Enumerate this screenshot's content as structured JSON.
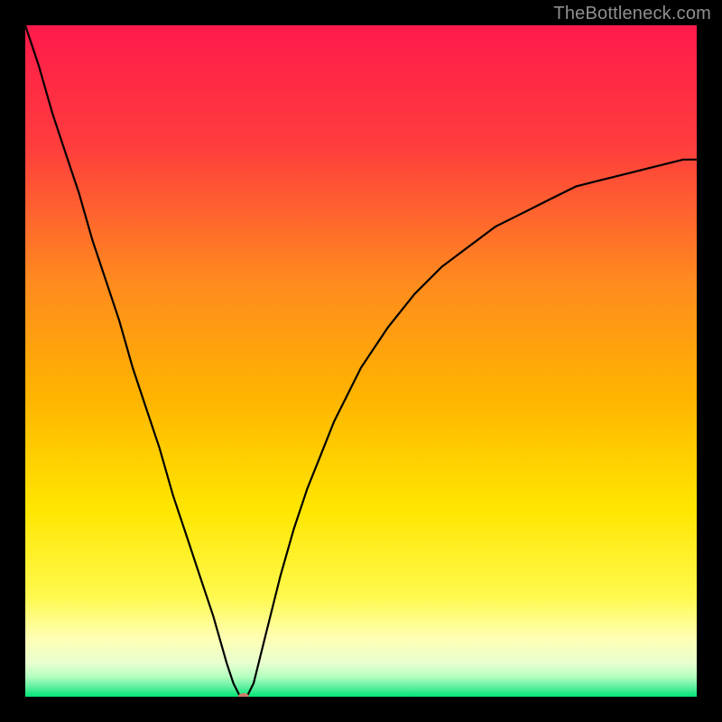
{
  "watermark": "TheBottleneck.com",
  "chart_data": {
    "type": "line",
    "title": "",
    "xlabel": "",
    "ylabel": "",
    "xlim": [
      0,
      100
    ],
    "ylim": [
      0,
      100
    ],
    "background": {
      "description": "vertical gradient mapped to y-value",
      "stops": [
        {
          "y": 100,
          "color": "#ff1a4b"
        },
        {
          "y": 50,
          "color": "#ffb300"
        },
        {
          "y": 28,
          "color": "#ffe600"
        },
        {
          "y": 12,
          "color": "#ffff9e"
        },
        {
          "y": 4,
          "color": "#e8ffd0"
        },
        {
          "y": 0,
          "color": "#00e676"
        }
      ]
    },
    "series": [
      {
        "name": "bottleneck-curve",
        "color": "#000000",
        "x": [
          0,
          2,
          4,
          6,
          8,
          10,
          12,
          14,
          16,
          18,
          20,
          22,
          24,
          26,
          28,
          30,
          31,
          32,
          33,
          34,
          35,
          36,
          38,
          40,
          42,
          44,
          46,
          48,
          50,
          54,
          58,
          62,
          66,
          70,
          74,
          78,
          82,
          86,
          90,
          94,
          98,
          100
        ],
        "y": [
          100,
          94,
          87,
          81,
          75,
          68,
          62,
          56,
          49,
          43,
          37,
          30,
          24,
          18,
          12,
          5,
          2,
          0,
          0,
          2,
          6,
          10,
          18,
          25,
          31,
          36,
          41,
          45,
          49,
          55,
          60,
          64,
          67,
          70,
          72,
          74,
          76,
          77,
          78,
          79,
          80,
          80
        ]
      }
    ],
    "marker": {
      "name": "optimal-point",
      "x": 32.5,
      "y": 0,
      "color": "#cf7a6b",
      "rx": 6,
      "ry": 4
    }
  }
}
